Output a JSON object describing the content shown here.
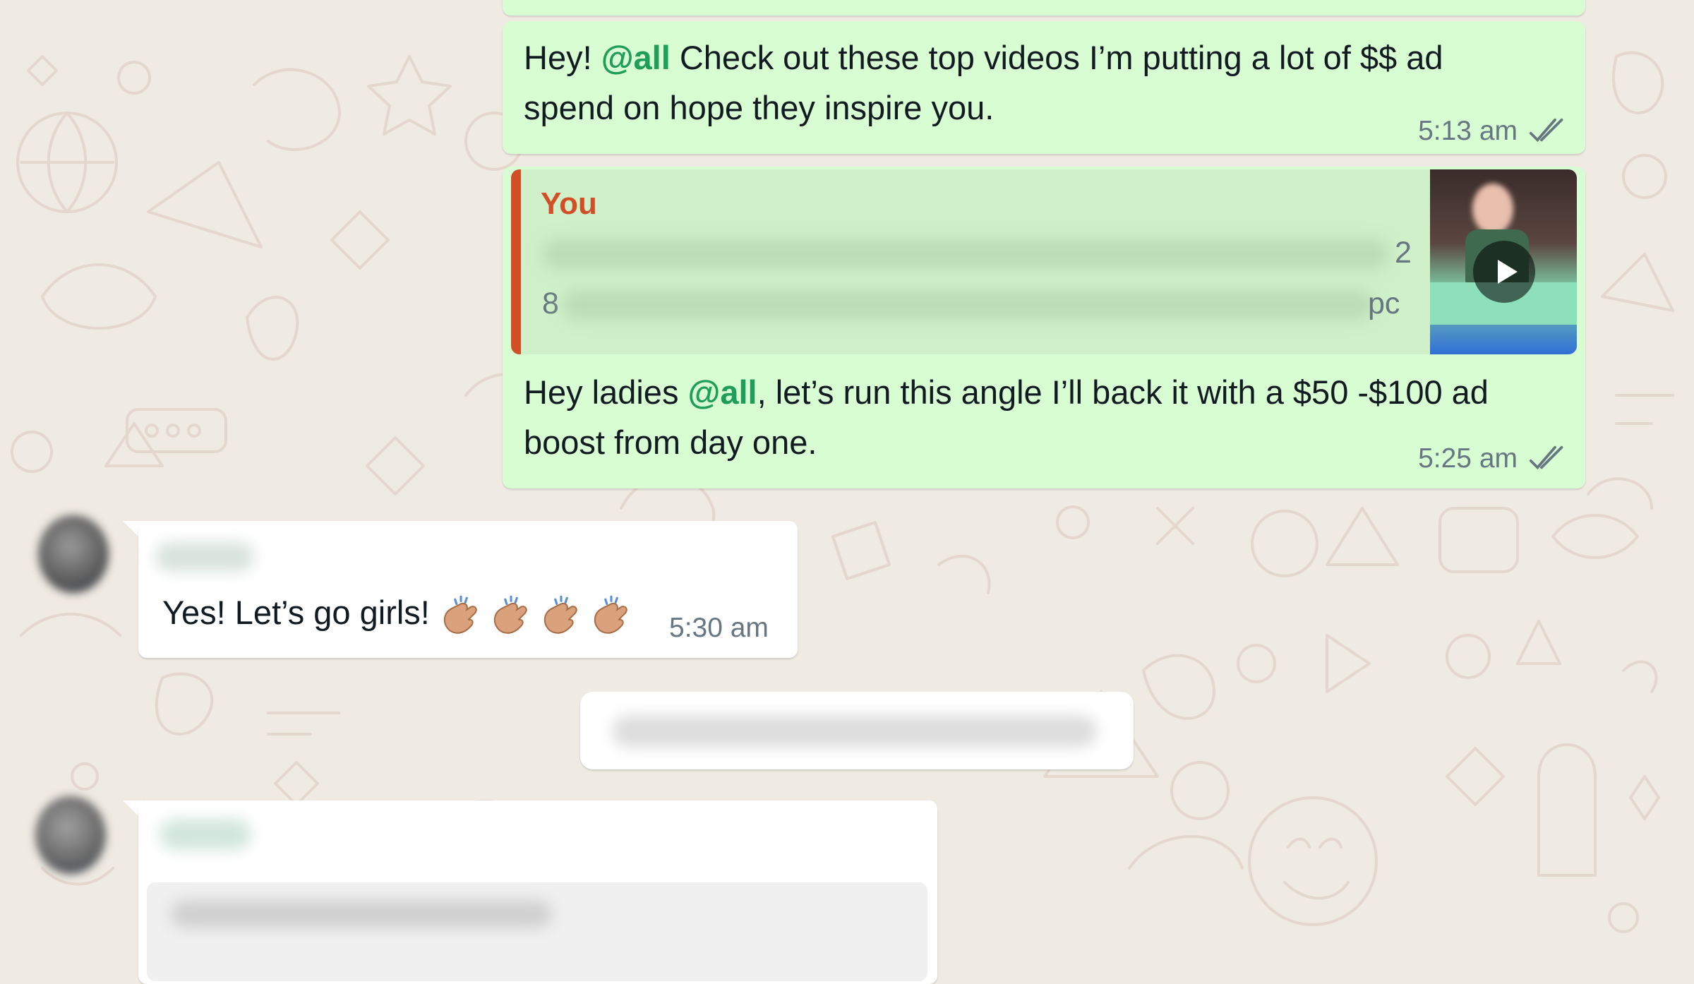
{
  "colors": {
    "outgoing_bubble": "#d9fdd3",
    "incoming_bubble": "#ffffff",
    "mention": "#1f9e5a",
    "quote_author": "#d24e26",
    "quote_bar": "#d24e26",
    "timestamp": "#667781",
    "wallpaper": "#efeae2"
  },
  "messages": [
    {
      "pre": "Hey! ",
      "mention": "@all",
      "post": " Check out these top videos I’m putting a lot of $$ ad spend on hope they inspire you.",
      "time": "5:13 am",
      "status_icon": "double-check-icon"
    },
    {
      "quote": {
        "author": "You",
        "line1_end": "2",
        "line2_start": "8",
        "line2_end": "pc",
        "thumbnail_icon": "play-icon"
      },
      "pre": "Hey ladies ",
      "mention": "@all",
      "post": ", let’s run this angle I’ll back it with a $50 -$100 ad boost from day one.",
      "time": "5:25 am",
      "status_icon": "double-check-icon"
    },
    {
      "text": "Yes! Let’s go girls! ",
      "emoji": [
        "clapping-hands",
        "clapping-hands",
        "clapping-hands",
        "clapping-hands"
      ],
      "time": "5:30 am"
    }
  ]
}
